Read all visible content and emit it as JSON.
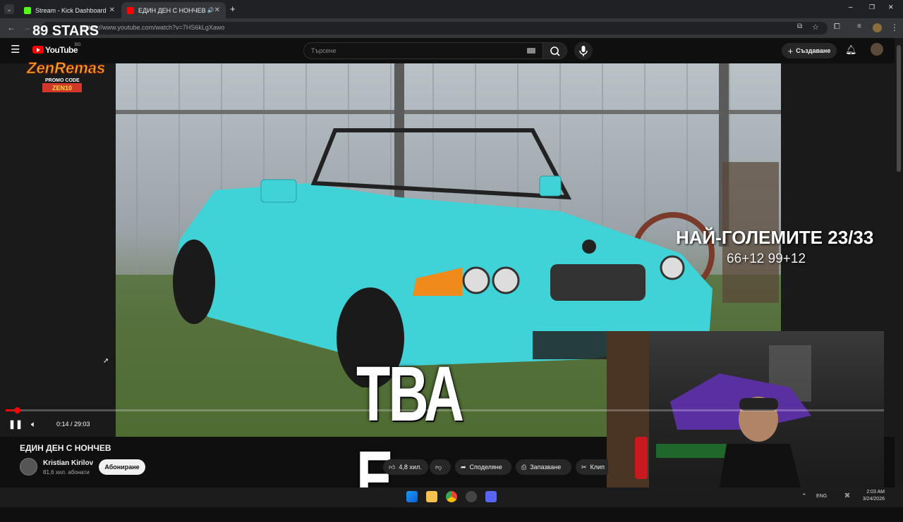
{
  "browser": {
    "tabs": [
      {
        "title": "Stream - Kick Dashboard",
        "color": "#53fc18"
      },
      {
        "title": "ЕДИН ДЕН С НОНЧЕВ - Yo",
        "color": "#ff0000"
      }
    ],
    "new_tab": "+",
    "url": "https://www.youtube.com/watch?v=7HS6kLgXawo",
    "window_controls": [
      "–",
      "❐",
      "✕"
    ]
  },
  "youtube": {
    "logo": "YouTube",
    "logo_region": "BG",
    "search_placeholder": "Търсене",
    "create_label": "Създаване"
  },
  "overlay": {
    "brand_top": "89 STARS",
    "brand_main": "ZenRemasta",
    "promo_label": "PROMO CODE",
    "promo_code": "ZEN10",
    "headline": "НАЙ-ГОЛЕМИТЕ 23/33",
    "subline": "66+12 99+12",
    "caption": "ТВА Е"
  },
  "player": {
    "time": "0:14 / 29:03",
    "progress_fraction": 0.008
  },
  "video": {
    "title": "ЕДИН ДЕН С НОНЧЕВ",
    "channel": "Kristian Kirilov",
    "subscribers": "81,6 хил. абонати",
    "subscribe_label": "Абониране",
    "likes": "4,8 хил.",
    "share_label": "Споделяне",
    "save_label": "Запазване",
    "clip_label": "Клип"
  },
  "taskbar": {
    "lang": "ENG",
    "time": "2:03 AM",
    "date": "3/24/2026"
  },
  "colors": {
    "accent_red": "#ff0000",
    "car": "#3fd3d8"
  }
}
